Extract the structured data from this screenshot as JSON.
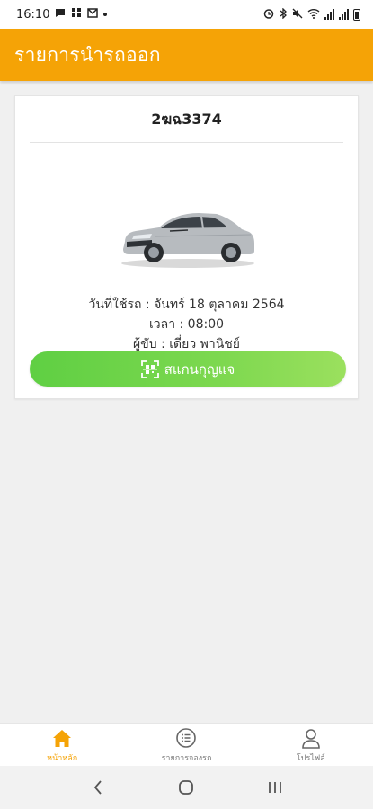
{
  "status_bar": {
    "time": "16:10",
    "notification_icons": [
      "message-icon",
      "grid-app-icon",
      "mail-icon"
    ],
    "system_icons": [
      "alarm-icon",
      "bluetooth-icon",
      "mute-icon",
      "wifi-icon",
      "signal-icon",
      "signal-icon",
      "battery-icon"
    ]
  },
  "header": {
    "title": "รายการนำรถออก"
  },
  "booking": {
    "plate": "2ฆฉ3374",
    "date_line": "วันที่ใช้รถ : จันทร์ 18 ตุลาคม 2564",
    "time_line": "เวลา : 08:00",
    "driver_line": "ผู้ขับ : เดี่ยว พานิชย์",
    "scan_button_label": "สแกนกุญแจ"
  },
  "bottom_nav": {
    "items": [
      {
        "label": "หน้าหลัก",
        "icon": "home-icon",
        "active": true
      },
      {
        "label": "รายการจองรถ",
        "icon": "list-icon",
        "active": false
      },
      {
        "label": "โปรไฟล์",
        "icon": "profile-icon",
        "active": false
      }
    ]
  },
  "colors": {
    "primary": "#f5a306",
    "button_green": "#6fd44a",
    "background": "#f0f0f0"
  }
}
